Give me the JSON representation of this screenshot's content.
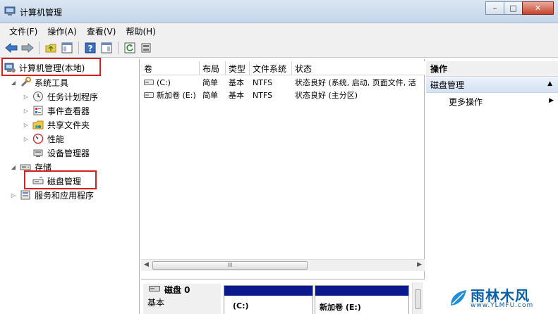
{
  "window": {
    "title": "计算机管理",
    "buttons": {
      "minimize": "–",
      "maximize": "□",
      "close": "✕"
    }
  },
  "menu": [
    "文件(F)",
    "操作(A)",
    "查看(V)",
    "帮助(H)"
  ],
  "tree": {
    "root": "计算机管理(本地)",
    "system_tools": "系统工具",
    "task_scheduler": "任务计划程序",
    "event_viewer": "事件查看器",
    "shared_folders": "共享文件夹",
    "performance": "性能",
    "device_manager": "设备管理器",
    "storage": "存储",
    "disk_management": "磁盘管理",
    "services_apps": "服务和应用程序"
  },
  "list": {
    "headers": [
      "卷",
      "布局",
      "类型",
      "文件系统",
      "状态"
    ],
    "rows": [
      {
        "volume": "(C:)",
        "layout": "简单",
        "type": "基本",
        "fs": "NTFS",
        "status": "状态良好 (系统, 启动, 页面文件, 活"
      },
      {
        "volume": "新加卷 (E:)",
        "layout": "简单",
        "type": "基本",
        "fs": "NTFS",
        "status": "状态良好 (主分区)"
      }
    ],
    "scroll_grip": "III"
  },
  "disk": {
    "name": "磁盘 0",
    "type": "基本",
    "volumes": [
      "(C:)",
      "新加卷  (E:)"
    ]
  },
  "actions": {
    "header": "操作",
    "section": "磁盘管理",
    "more": "更多操作"
  },
  "watermark": {
    "text": "雨林木风",
    "url": "www.YLMFU.com"
  },
  "colors": {
    "highlight": "#d6201f",
    "volume_strip": "#0a1a8c",
    "watermark": "#0a5fa8"
  }
}
